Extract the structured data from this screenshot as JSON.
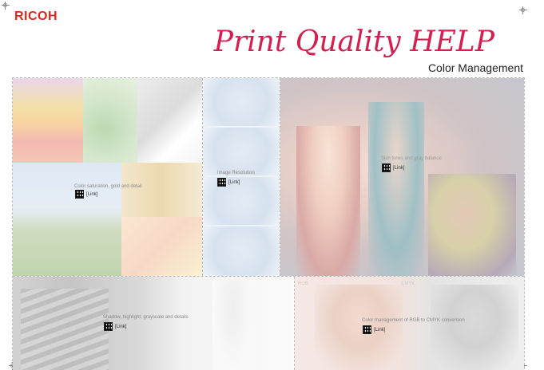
{
  "header": {
    "logo": "RICOH",
    "title": "Print Quality HELP",
    "subtitle": "Color Management"
  },
  "sections": [
    {
      "caption": "Color saturation, gold and detail",
      "link": "[Link]"
    },
    {
      "caption": "Image Resolution",
      "link": "[Link]"
    },
    {
      "caption": "Skin tones and gray balance",
      "link": "[Link]"
    },
    {
      "caption": "Shadow, highlight, grayscale and details",
      "link": "[Link]"
    },
    {
      "caption": "Color management of RGB to CMYK conversion",
      "link": "[Link]"
    }
  ],
  "overlay_labels": {
    "rgb": "RGB",
    "cmyk": "CMYK"
  }
}
